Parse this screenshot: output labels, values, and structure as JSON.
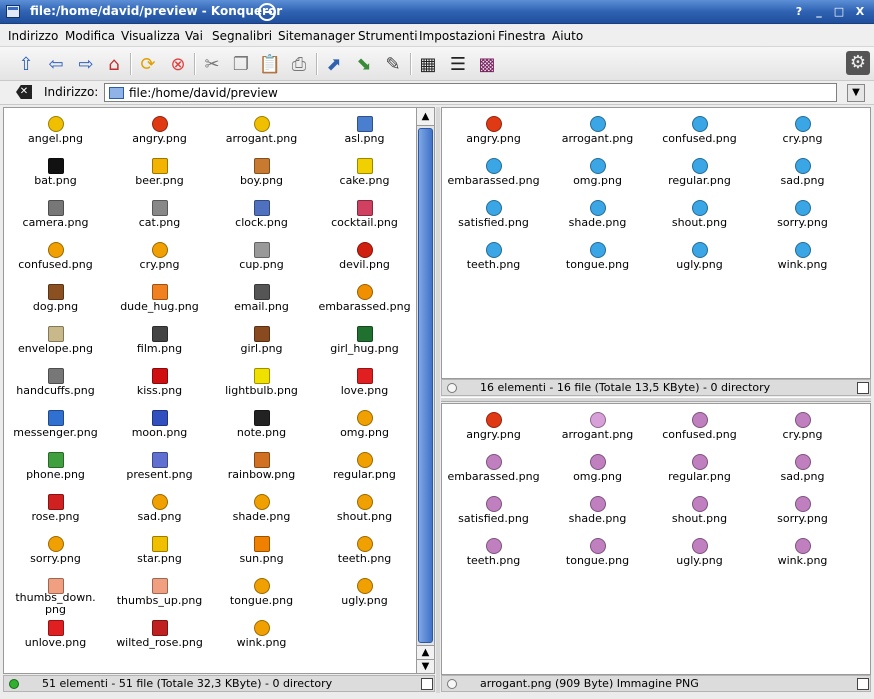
{
  "window": {
    "title": "file:/home/david/preview - Konqueror",
    "buttons": [
      "?",
      "_",
      "□",
      "X"
    ]
  },
  "menubar": [
    "Indirizzo",
    "Modifica",
    "Visualizza",
    "Vai",
    "Segnalibri",
    "Sitemanager",
    "Strumenti",
    "Impostazioni",
    "Finestra",
    "Aiuto"
  ],
  "toolbar": {
    "icons": [
      "up-arrow-icon",
      "back-arrow-icon",
      "forward-arrow-icon",
      "home-icon",
      "reload-icon",
      "stop-icon",
      "cut-icon",
      "copy-icon",
      "paste-icon",
      "print-icon",
      "zoom-in-icon",
      "zoom-out-icon",
      "edit-icon",
      "icon-view-icon",
      "tree-view-icon",
      "thumbnail-view-icon"
    ]
  },
  "location": {
    "label": "Indirizzo:",
    "value": "file:/home/david/preview"
  },
  "left_pane": {
    "items": [
      {
        "name": "angel.png",
        "icon": "angel-smiley",
        "color": "#f0c000"
      },
      {
        "name": "angry.png",
        "icon": "angry-smiley",
        "color": "#e03a14"
      },
      {
        "name": "arrogant.png",
        "icon": "arrogant-smiley",
        "color": "#f0c000"
      },
      {
        "name": "asl.png",
        "icon": "question-icon",
        "color": "#4a7fd0"
      },
      {
        "name": "bat.png",
        "icon": "bat-icon",
        "color": "#111111"
      },
      {
        "name": "beer.png",
        "icon": "beer-icon",
        "color": "#f2b400"
      },
      {
        "name": "boy.png",
        "icon": "boy-icon",
        "color": "#c87a30"
      },
      {
        "name": "cake.png",
        "icon": "cake-icon",
        "color": "#f0d000"
      },
      {
        "name": "camera.png",
        "icon": "camera-icon",
        "color": "#777777"
      },
      {
        "name": "cat.png",
        "icon": "cat-icon",
        "color": "#888888"
      },
      {
        "name": "clock.png",
        "icon": "clock-icon",
        "color": "#5070c0"
      },
      {
        "name": "cocktail.png",
        "icon": "cocktail-icon",
        "color": "#d04060"
      },
      {
        "name": "confused.png",
        "icon": "confused-smiley",
        "color": "#f0a000"
      },
      {
        "name": "cry.png",
        "icon": "cry-smiley",
        "color": "#f0a000"
      },
      {
        "name": "cup.png",
        "icon": "cup-icon",
        "color": "#999999"
      },
      {
        "name": "devil.png",
        "icon": "devil-smiley",
        "color": "#d02010"
      },
      {
        "name": "dog.png",
        "icon": "dog-icon",
        "color": "#8a5020"
      },
      {
        "name": "dude_hug.png",
        "icon": "dude-hug-icon",
        "color": "#f08020"
      },
      {
        "name": "email.png",
        "icon": "email-icon",
        "color": "#555555"
      },
      {
        "name": "embarassed.png",
        "icon": "embarassed-smiley",
        "color": "#f09000"
      },
      {
        "name": "envelope.png",
        "icon": "envelope-icon",
        "color": "#c8b88a"
      },
      {
        "name": "film.png",
        "icon": "film-icon",
        "color": "#444444"
      },
      {
        "name": "girl.png",
        "icon": "girl-icon",
        "color": "#8a4a20"
      },
      {
        "name": "girl_hug.png",
        "icon": "girl-hug-icon",
        "color": "#207030"
      },
      {
        "name": "handcuffs.png",
        "icon": "handcuffs-icon",
        "color": "#777777"
      },
      {
        "name": "kiss.png",
        "icon": "kiss-icon",
        "color": "#d01010"
      },
      {
        "name": "lightbulb.png",
        "icon": "lightbulb-icon",
        "color": "#f0e000"
      },
      {
        "name": "love.png",
        "icon": "heart-icon",
        "color": "#e02020"
      },
      {
        "name": "messenger.png",
        "icon": "messenger-icon",
        "color": "#3070d0"
      },
      {
        "name": "moon.png",
        "icon": "moon-icon",
        "color": "#3050c0"
      },
      {
        "name": "note.png",
        "icon": "note-icon",
        "color": "#222222"
      },
      {
        "name": "omg.png",
        "icon": "omg-smiley",
        "color": "#f0a000"
      },
      {
        "name": "phone.png",
        "icon": "phone-icon",
        "color": "#40a040"
      },
      {
        "name": "present.png",
        "icon": "present-icon",
        "color": "#6070d0"
      },
      {
        "name": "rainbow.png",
        "icon": "rainbow-icon",
        "color": "#d07020"
      },
      {
        "name": "regular.png",
        "icon": "regular-smiley",
        "color": "#f0a000"
      },
      {
        "name": "rose.png",
        "icon": "rose-icon",
        "color": "#d02020"
      },
      {
        "name": "sad.png",
        "icon": "sad-smiley",
        "color": "#f0a000"
      },
      {
        "name": "shade.png",
        "icon": "shade-smiley",
        "color": "#f0a000"
      },
      {
        "name": "shout.png",
        "icon": "shout-smiley",
        "color": "#f0a000"
      },
      {
        "name": "sorry.png",
        "icon": "sorry-smiley",
        "color": "#f0a000"
      },
      {
        "name": "star.png",
        "icon": "star-icon",
        "color": "#f0c000"
      },
      {
        "name": "sun.png",
        "icon": "sun-icon",
        "color": "#f08000"
      },
      {
        "name": "teeth.png",
        "icon": "teeth-smiley",
        "color": "#f0a000"
      },
      {
        "name": "thumbs_down.\npng",
        "icon": "thumbs-down-icon",
        "color": "#f0a080"
      },
      {
        "name": "thumbs_up.png",
        "icon": "thumbs-up-icon",
        "color": "#f0a080"
      },
      {
        "name": "tongue.png",
        "icon": "tongue-smiley",
        "color": "#f0a000"
      },
      {
        "name": "ugly.png",
        "icon": "ugly-smiley",
        "color": "#f0a000"
      },
      {
        "name": "unlove.png",
        "icon": "broken-heart-icon",
        "color": "#e02020"
      },
      {
        "name": "wilted_rose.png",
        "icon": "wilted-rose-icon",
        "color": "#c02020"
      },
      {
        "name": "wink.png",
        "icon": "wink-smiley",
        "color": "#f0a000"
      }
    ],
    "status": "51 elementi - 51 file (Totale 32,3 KByte) - 0 directory"
  },
  "right_top_pane": {
    "items": [
      {
        "name": "angry.png",
        "color": "#e03a14"
      },
      {
        "name": "arrogant.png",
        "color": "#3aa6e6"
      },
      {
        "name": "confused.png",
        "color": "#3aa6e6"
      },
      {
        "name": "cry.png",
        "color": "#3aa6e6"
      },
      {
        "name": "embarassed.png",
        "color": "#3aa6e6"
      },
      {
        "name": "omg.png",
        "color": "#3aa6e6"
      },
      {
        "name": "regular.png",
        "color": "#3aa6e6"
      },
      {
        "name": "sad.png",
        "color": "#3aa6e6"
      },
      {
        "name": "satisfied.png",
        "color": "#3aa6e6"
      },
      {
        "name": "shade.png",
        "color": "#3aa6e6"
      },
      {
        "name": "shout.png",
        "color": "#3aa6e6"
      },
      {
        "name": "sorry.png",
        "color": "#3aa6e6"
      },
      {
        "name": "teeth.png",
        "color": "#3aa6e6"
      },
      {
        "name": "tongue.png",
        "color": "#3aa6e6"
      },
      {
        "name": "ugly.png",
        "color": "#3aa6e6"
      },
      {
        "name": "wink.png",
        "color": "#3aa6e6"
      }
    ],
    "status": "16 elementi - 16 file (Totale 13,5 KByte) - 0 directory"
  },
  "right_bottom_pane": {
    "items": [
      {
        "name": "angry.png",
        "color": "#e03a14"
      },
      {
        "name": "arrogant.png",
        "color": "#d8a0d8"
      },
      {
        "name": "confused.png",
        "color": "#c080c0"
      },
      {
        "name": "cry.png",
        "color": "#c080c0"
      },
      {
        "name": "embarassed.png",
        "color": "#c080c0"
      },
      {
        "name": "omg.png",
        "color": "#c080c0"
      },
      {
        "name": "regular.png",
        "color": "#c080c0"
      },
      {
        "name": "sad.png",
        "color": "#c080c0"
      },
      {
        "name": "satisfied.png",
        "color": "#c080c0"
      },
      {
        "name": "shade.png",
        "color": "#c080c0"
      },
      {
        "name": "shout.png",
        "color": "#c080c0"
      },
      {
        "name": "sorry.png",
        "color": "#c080c0"
      },
      {
        "name": "teeth.png",
        "color": "#c080c0"
      },
      {
        "name": "tongue.png",
        "color": "#c080c0"
      },
      {
        "name": "ugly.png",
        "color": "#c080c0"
      },
      {
        "name": "wink.png",
        "color": "#c080c0"
      }
    ],
    "status": "arrogant.png (909 Byte)  Immagine PNG"
  }
}
